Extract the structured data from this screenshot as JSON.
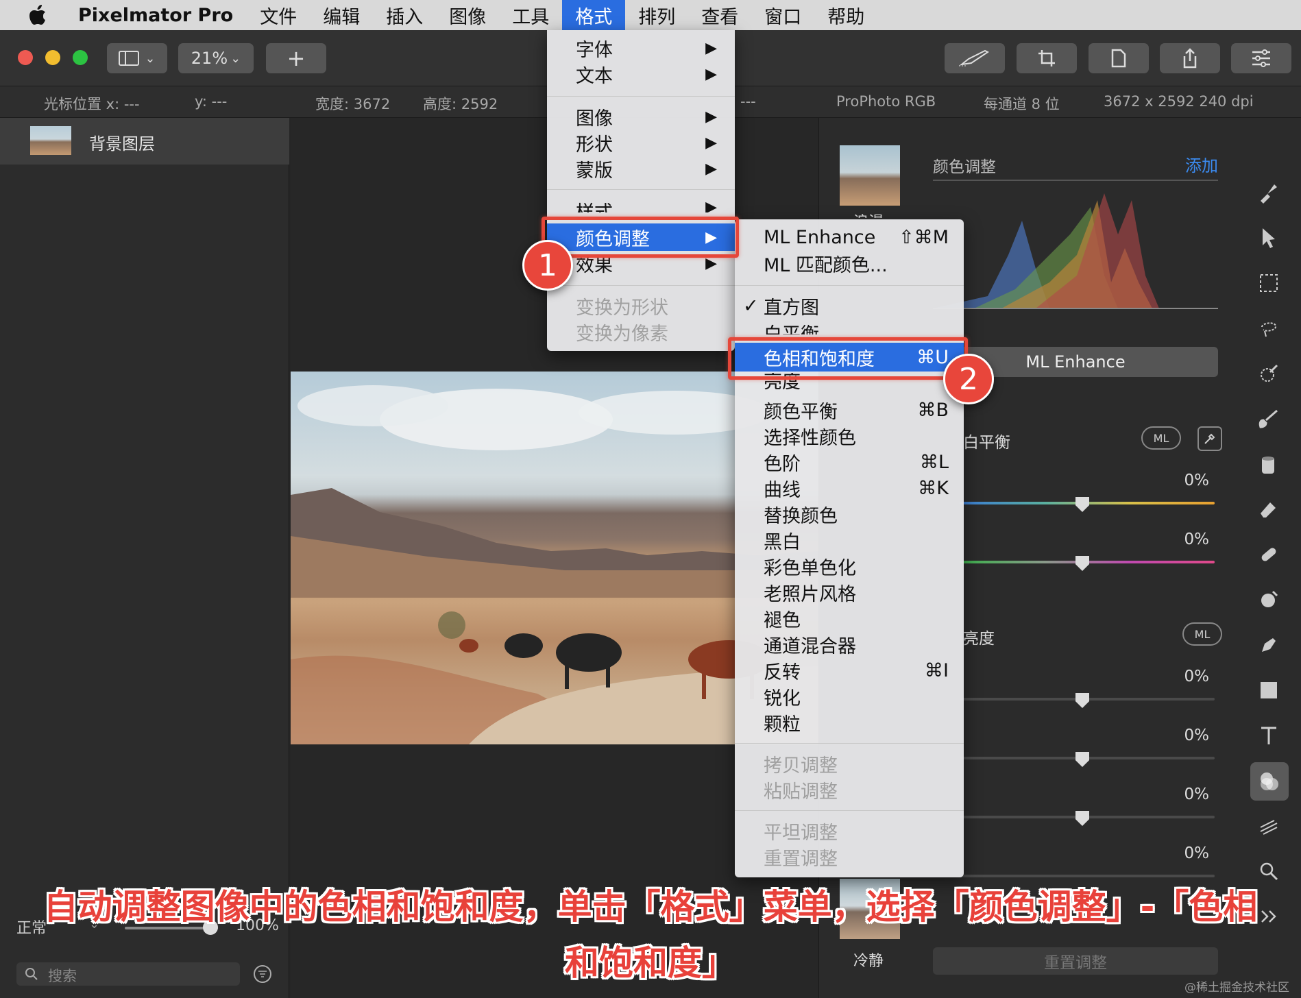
{
  "menubar": {
    "app": "Pixelmator Pro",
    "items": [
      "文件",
      "编辑",
      "插入",
      "图像",
      "工具",
      "格式",
      "排列",
      "查看",
      "窗口",
      "帮助"
    ],
    "active": "格式"
  },
  "toolbar": {
    "zoom": "21%",
    "add": "+"
  },
  "infobar": {
    "cursor_x": "光标位置 x:  ---",
    "cursor_y": "y:  ---",
    "width": "宽度: 3672",
    "height": "高度: 2592",
    "dash": "---",
    "profile": "ProPhoto RGB",
    "depth": "每通道 8 位",
    "size": "3672 x 2592 240 dpi"
  },
  "layers": {
    "layer_name": "背景图层",
    "blend_mode": "正常",
    "opacity": "100%",
    "search_placeholder": "搜索"
  },
  "format_menu": {
    "items": [
      {
        "label": "字体",
        "arrow": "▶"
      },
      {
        "label": "文本",
        "arrow": "▶"
      },
      {
        "label": "图像",
        "arrow": "▶"
      },
      {
        "label": "形状",
        "arrow": "▶"
      },
      {
        "label": "蒙版",
        "arrow": "▶"
      },
      {
        "label": "样式",
        "arrow": "▶"
      },
      {
        "label": "颜色调整",
        "arrow": "▶"
      },
      {
        "label": "效果",
        "arrow": "▶"
      },
      {
        "label": "变换为形状",
        "arrow": ""
      },
      {
        "label": "变换为像素",
        "arrow": ""
      }
    ]
  },
  "color_menu": {
    "items": [
      {
        "label": "ML Enhance",
        "shortcut": "⇧⌘M"
      },
      {
        "label": "ML 匹配颜色...",
        "shortcut": ""
      },
      {
        "label": "直方图",
        "shortcut": "",
        "check": "✓"
      },
      {
        "label": "白平衡",
        "shortcut": ""
      },
      {
        "label": "色相和饱和度",
        "shortcut": "⌘U"
      },
      {
        "label": "亮度",
        "shortcut": ""
      },
      {
        "label": "颜色平衡",
        "shortcut": "⌘B"
      },
      {
        "label": "选择性颜色",
        "shortcut": ""
      },
      {
        "label": "色阶",
        "shortcut": "⌘L"
      },
      {
        "label": "曲线",
        "shortcut": "⌘K"
      },
      {
        "label": "替换颜色",
        "shortcut": ""
      },
      {
        "label": "黑白",
        "shortcut": ""
      },
      {
        "label": "彩色单色化",
        "shortcut": ""
      },
      {
        "label": "老照片风格",
        "shortcut": ""
      },
      {
        "label": "褪色",
        "shortcut": ""
      },
      {
        "label": "通道混合器",
        "shortcut": ""
      },
      {
        "label": "反转",
        "shortcut": "⌘I"
      },
      {
        "label": "锐化",
        "shortcut": ""
      },
      {
        "label": "颗粒",
        "shortcut": ""
      },
      {
        "label": "拷贝调整",
        "shortcut": ""
      },
      {
        "label": "粘贴调整",
        "shortcut": ""
      },
      {
        "label": "平坦调整",
        "shortcut": ""
      },
      {
        "label": "重置调整",
        "shortcut": ""
      }
    ]
  },
  "right_panel": {
    "title": "颜色调整",
    "add": "添加",
    "preset_label_top": "浪漫",
    "preset_label_bottom": "冷静",
    "ml_enhance": "ML Enhance",
    "white_balance": "白平衡",
    "brightness": "亮度",
    "ml": "ML",
    "pct": "0%",
    "reset": "重置调整"
  },
  "badges": [
    "1",
    "2"
  ],
  "caption": "自动调整图像中的色相和饱和度，单击「格式」菜单，选择「颜色调整」-「色相和饱和度」",
  "watermark": "@稀土掘金技术社区"
}
